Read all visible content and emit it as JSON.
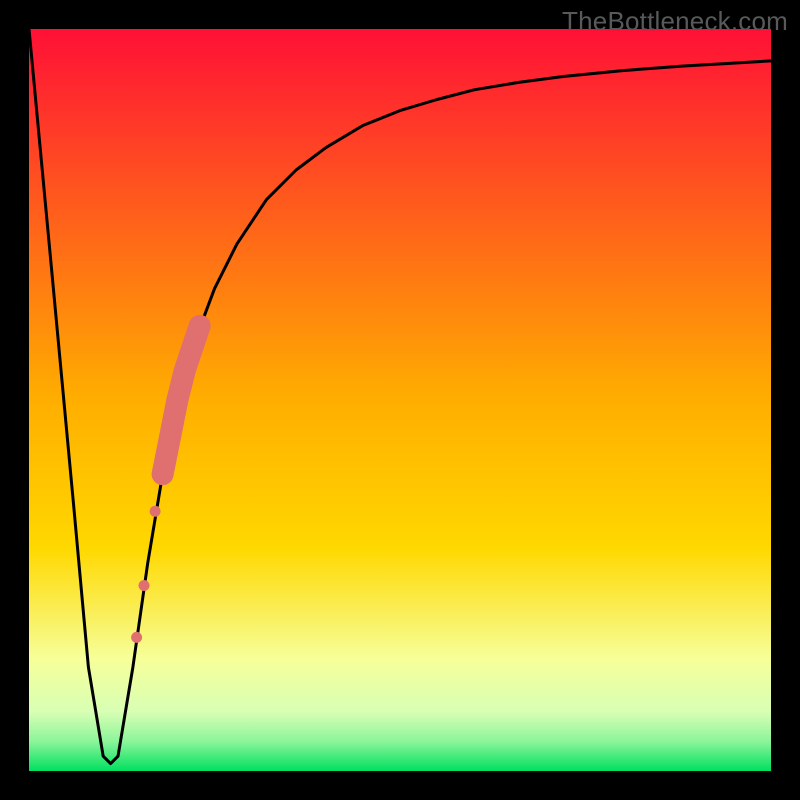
{
  "chart_data": {
    "type": "line",
    "title": "",
    "xlabel": "",
    "ylabel": "",
    "xlim": [
      0,
      100
    ],
    "ylim": [
      0,
      100
    ],
    "series": [
      {
        "name": "bottleneck-curve",
        "x": [
          0,
          3,
          6,
          8,
          10,
          11,
          12,
          14,
          16,
          18,
          20,
          22,
          25,
          28,
          32,
          36,
          40,
          45,
          50,
          55,
          60,
          66,
          72,
          80,
          88,
          95,
          100
        ],
        "values": [
          100,
          68,
          36,
          14,
          2,
          1,
          2,
          14,
          28,
          40,
          50,
          57,
          65,
          71,
          77,
          81,
          84,
          87,
          89,
          90.5,
          91.8,
          92.8,
          93.6,
          94.4,
          95,
          95.4,
          95.7
        ]
      }
    ],
    "highlight_points": {
      "name": "recommended-range",
      "color": "#e07070",
      "x": [
        14.5,
        15.5,
        17,
        18,
        19,
        20,
        21,
        22,
        23
      ],
      "values": [
        18,
        25,
        35,
        40,
        45,
        50,
        54,
        57,
        60
      ],
      "size": [
        11,
        11,
        11,
        22,
        22,
        22,
        22,
        22,
        22
      ]
    },
    "background_gradient": {
      "top": "#ff1036",
      "mid": "#ffd800",
      "bottom_band": "#f6ff9a",
      "base": "#00e060"
    }
  },
  "watermark": "TheBottleneck.com"
}
